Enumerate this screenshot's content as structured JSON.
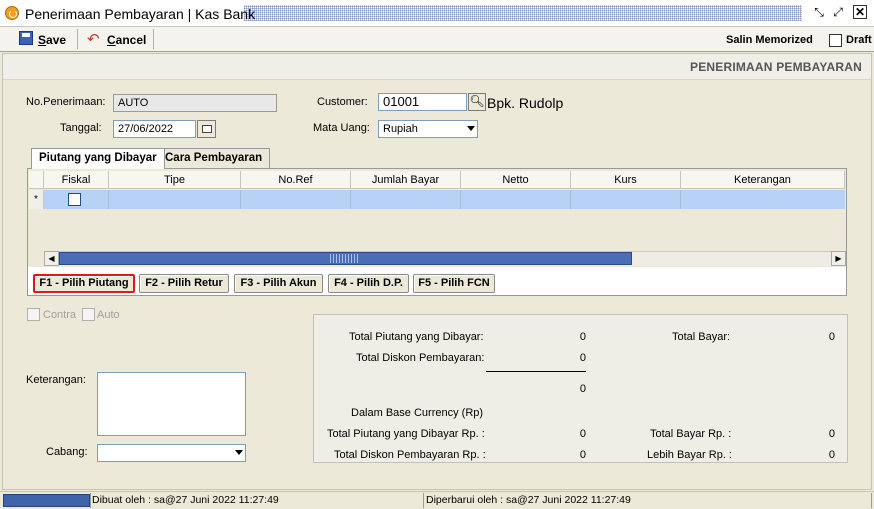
{
  "window": {
    "title": "Penerimaan Pembayaran | Kas Bank"
  },
  "toolbar": {
    "save_label": "ave",
    "save_accel": "S",
    "cancel_label": "ancel",
    "cancel_accel": "C",
    "salin_memorized": "Salin Memorized",
    "draft_label": "Draft"
  },
  "page": {
    "heading": "PENERIMAAN PEMBAYARAN"
  },
  "form": {
    "no_penerimaan_label": "No.Penerimaan:",
    "no_penerimaan_value": "AUTO",
    "tanggal_label": "Tanggal:",
    "tanggal_value": "27/06/2022",
    "customer_label": "Customer:",
    "customer_value": "01001",
    "customer_name": "Bpk. Rudolp",
    "mata_uang_label": "Mata Uang:",
    "mata_uang_value": "Rupiah"
  },
  "tabs": [
    {
      "label": "Piutang yang Dibayar",
      "active": true
    },
    {
      "label": "Cara Pembayaran",
      "active": false
    }
  ],
  "grid": {
    "columns": [
      "Fiskal",
      "Tipe",
      "No.Ref",
      "Jumlah Bayar",
      "Netto",
      "Kurs",
      "Keterangan"
    ],
    "new_row_marker": "*"
  },
  "function_buttons": [
    "F1 - Pilih Piutang",
    "F2 - Pilih Retur",
    "F3 - Pilih Akun",
    "F4 - Pilih D.P.",
    "F5 - Pilih FCN"
  ],
  "options": {
    "contra": "Contra",
    "auto": "Auto"
  },
  "notes": {
    "keterangan_label": "Keterangan:",
    "cabang_label": "Cabang:",
    "cabang_value": ""
  },
  "totals": {
    "total_piutang_label": "Total Piutang yang Dibayar:",
    "total_piutang_value": "0",
    "total_diskon_label": "Total Diskon Pembayaran:",
    "total_diskon_value": "0",
    "subtotal_value": "0",
    "total_bayar_label": "Total Bayar:",
    "total_bayar_value": "0",
    "base_currency_label": "Dalam Base Currency (Rp)",
    "total_piutang_rp_label": "Total Piutang yang Dibayar Rp. :",
    "total_piutang_rp_value": "0",
    "total_diskon_rp_label": "Total Diskon Pembayaran Rp. :",
    "total_diskon_rp_value": "0",
    "total_bayar_rp_label": "Total Bayar Rp. :",
    "total_bayar_rp_value": "0",
    "lebih_bayar_rp_label": "Lebih Bayar Rp. :",
    "lebih_bayar_rp_value": "0"
  },
  "status": {
    "dibuat": "Dibuat oleh : sa@27 Juni 2022  11:27:49",
    "diperbarui": "Diperbarui oleh : sa@27 Juni 2022  11:27:49"
  }
}
